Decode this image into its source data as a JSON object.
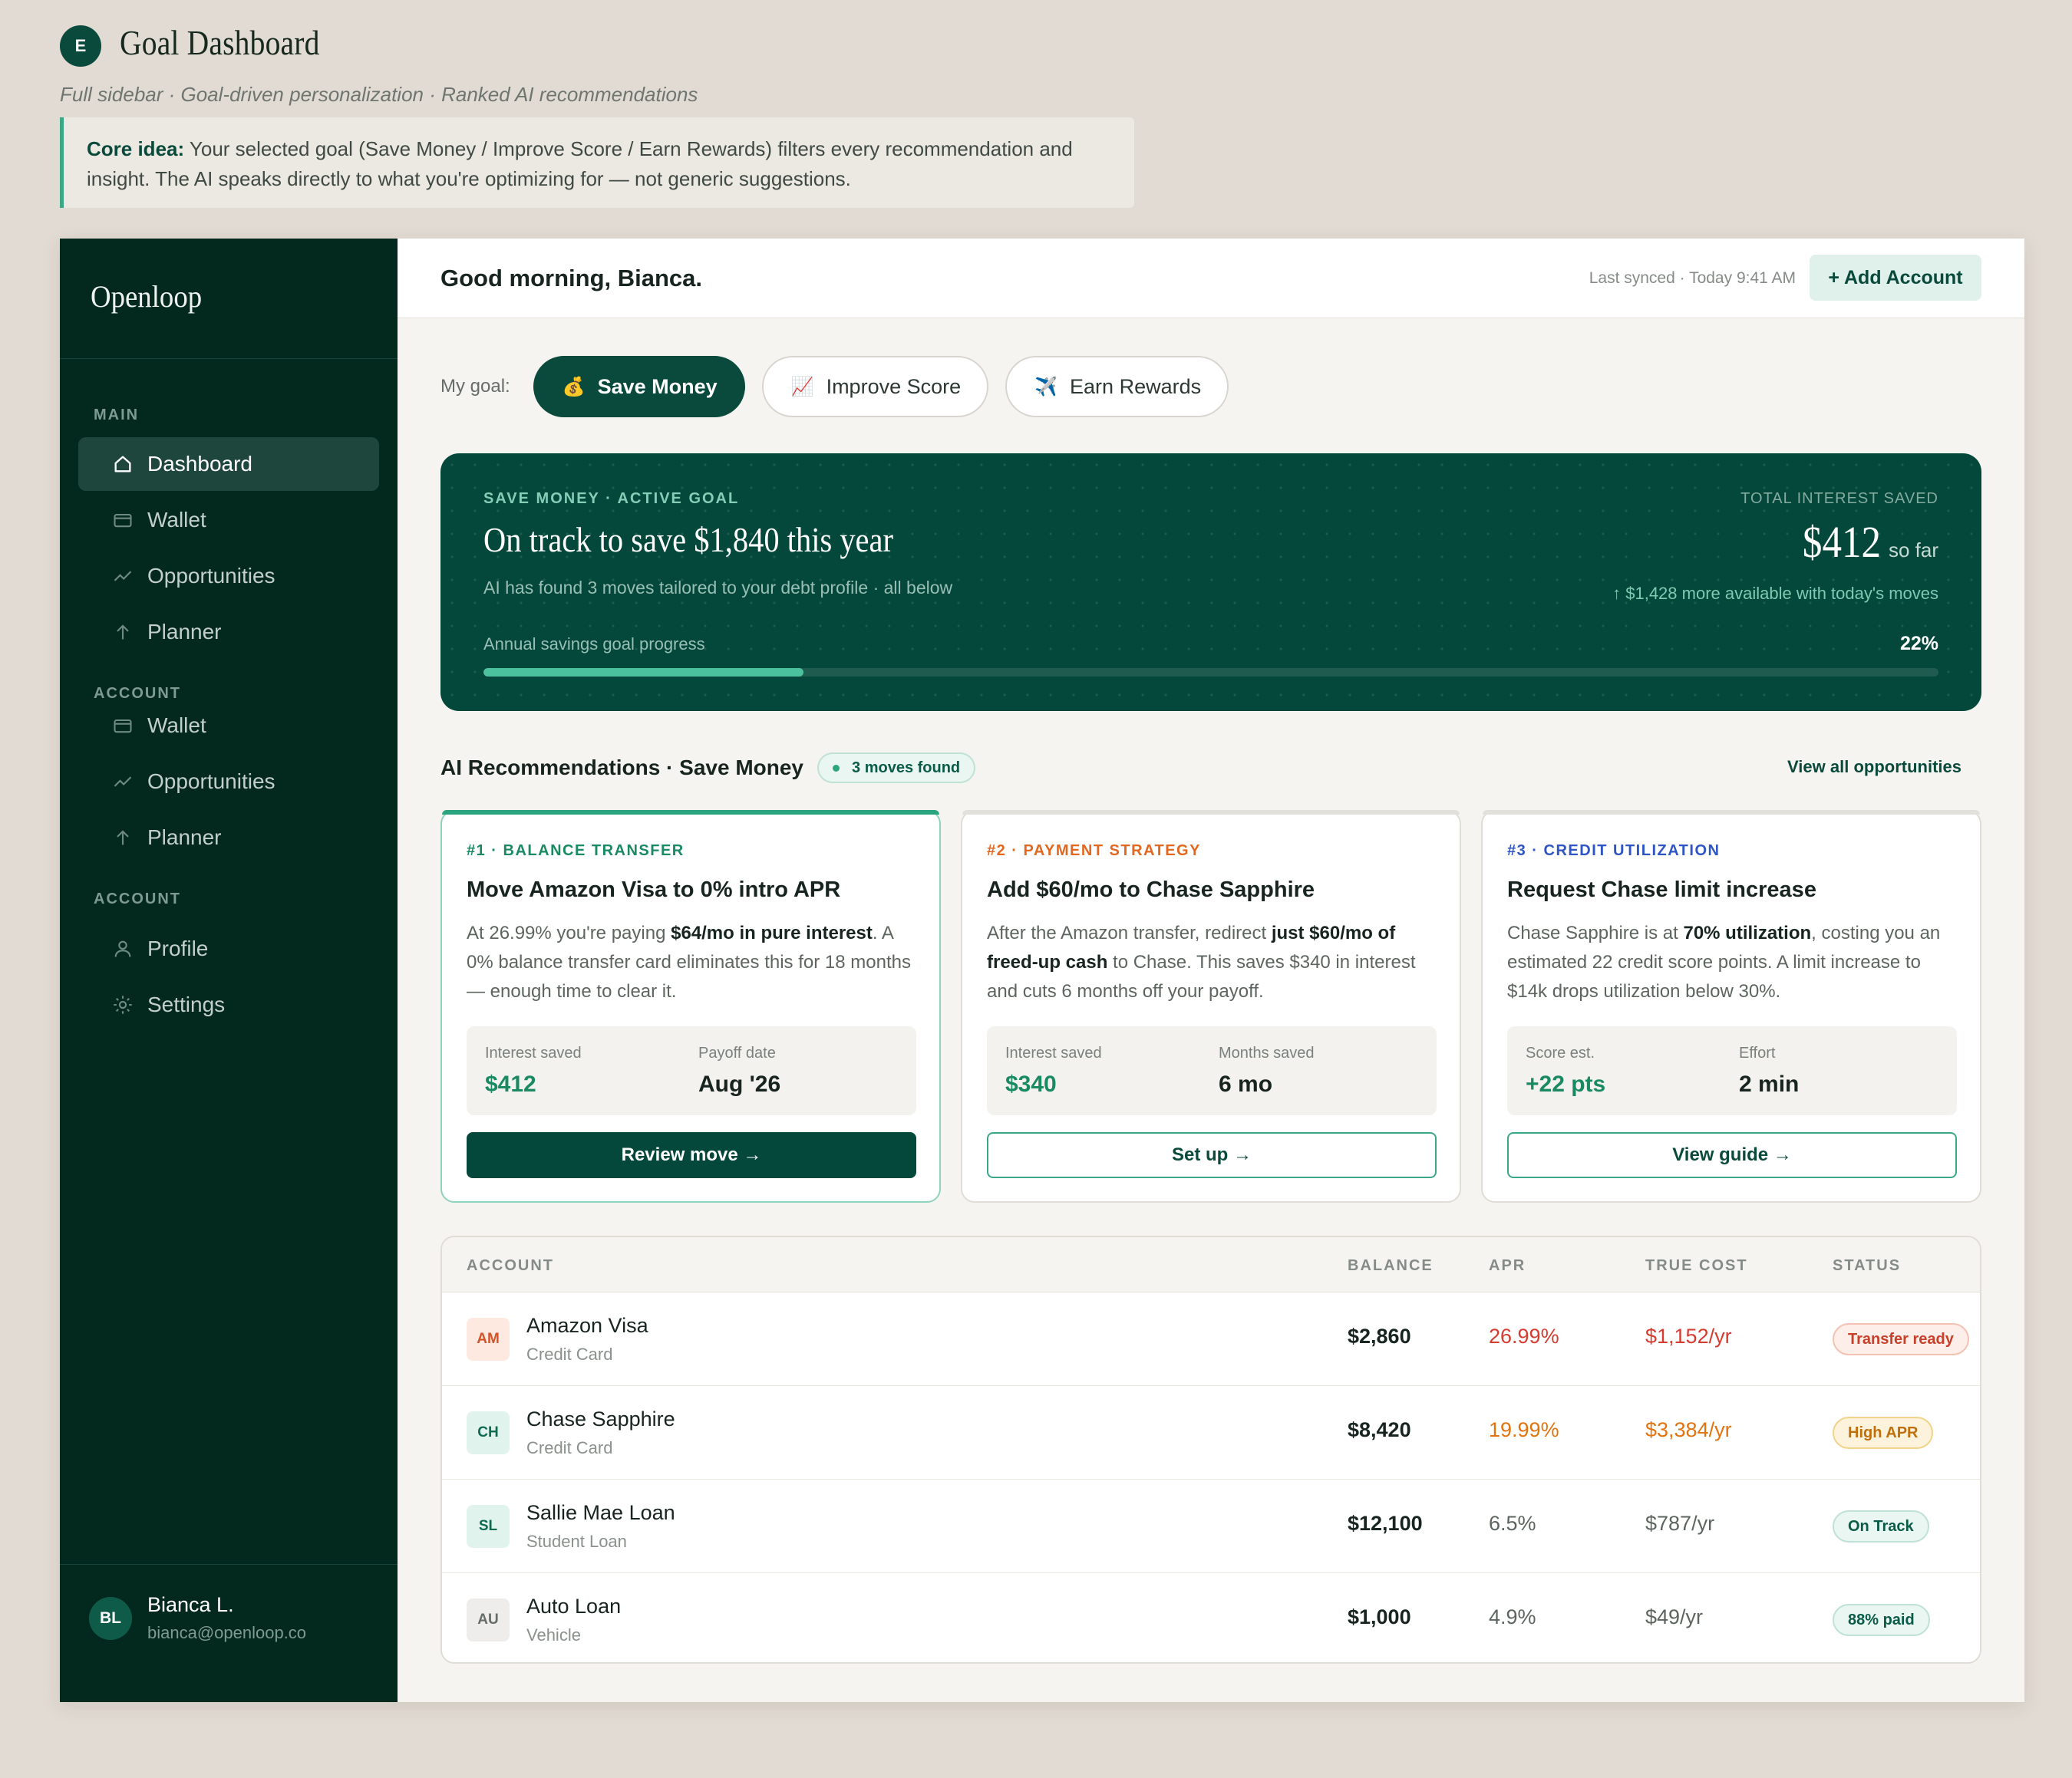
{
  "page": {
    "badge": "E",
    "title": "Goal Dashboard",
    "subtitle": "Full sidebar · Goal-driven personalization · Ranked AI recommendations",
    "core_idea_label": "Core idea:",
    "core_idea_text": " Your selected goal (Save Money / Improve Score / Earn Rewards) filters every recommendation and insight. The AI speaks directly to what you're optimizing for — not generic suggestions."
  },
  "sidebar": {
    "brand": "Openloop",
    "sections": [
      {
        "label": "MAIN",
        "items": [
          {
            "label": "Dashboard",
            "icon": "home-icon",
            "active": true
          },
          {
            "label": "Wallet",
            "icon": "wallet-icon"
          },
          {
            "label": "Opportunities",
            "icon": "trend-icon"
          },
          {
            "label": "Planner",
            "icon": "arrow-up-icon"
          }
        ]
      },
      {
        "label": "ACCOUNT",
        "items": [
          {
            "label": "Wallet",
            "icon": "wallet-icon"
          },
          {
            "label": "Opportunities",
            "icon": "trend-icon"
          },
          {
            "label": "Planner",
            "icon": "arrow-up-icon"
          }
        ]
      },
      {
        "label": "ACCOUNT",
        "items": [
          {
            "label": "Profile",
            "icon": "user-icon"
          },
          {
            "label": "Settings",
            "icon": "gear-icon"
          }
        ]
      }
    ],
    "user": {
      "initials": "BL",
      "name": "Bianca L.",
      "email": "bianca@openloop.co"
    }
  },
  "topbar": {
    "greeting": "Good morning, Bianca.",
    "synced": "Last synced · Today 9:41 AM",
    "add_account": "+ Add Account"
  },
  "goals": {
    "label": "My goal:",
    "options": [
      {
        "emoji": "💰",
        "label": "Save Money",
        "selected": true
      },
      {
        "emoji": "📈",
        "label": "Improve Score",
        "selected": false
      },
      {
        "emoji": "✈️",
        "label": "Earn Rewards",
        "selected": false
      }
    ]
  },
  "hero": {
    "tag": "SAVE MONEY · ACTIVE GOAL",
    "headline": "On track to save $1,840 this year",
    "sub": "AI has found 3 moves tailored to your debt profile · all below",
    "total_label": "TOTAL INTEREST SAVED",
    "total_amount": "$412",
    "total_suffix": "so far",
    "more": "↑ $1,428 more available with today's moves",
    "progress_label": "Annual savings goal progress",
    "progress_pct": "22%",
    "progress_value": 22
  },
  "recs": {
    "title": "AI Recommendations · Save Money",
    "badge": "3 moves found",
    "view_all": "View all opportunities",
    "cards": [
      {
        "tag": "#1 · BALANCE TRANSFER",
        "tag_color": "#1a8a63",
        "title": "Move Amazon Visa to 0% intro APR",
        "desc_parts": [
          "At 26.99% you're paying ",
          "$64/mo in pure interest",
          ". A 0% balance transfer card eliminates this for 18 months — enough time to clear it."
        ],
        "stats": [
          {
            "label": "Interest saved",
            "value": "$412",
            "green": true
          },
          {
            "label": "Payoff date",
            "value": "Aug '26",
            "green": false
          }
        ],
        "button": "Review move →",
        "button_style": "solid"
      },
      {
        "tag": "#2 · PAYMENT STRATEGY",
        "tag_color": "#e2671f",
        "title": "Add $60/mo to Chase Sapphire",
        "desc_parts": [
          "After the Amazon transfer, redirect ",
          "just $60/mo of freed-up cash",
          " to Chase. This saves $340 in interest and cuts 6 months off your payoff."
        ],
        "stats": [
          {
            "label": "Interest saved",
            "value": "$340",
            "green": true
          },
          {
            "label": "Months saved",
            "value": "6 mo",
            "green": false
          }
        ],
        "button": "Set up →",
        "button_style": "out"
      },
      {
        "tag": "#3 · CREDIT UTILIZATION",
        "tag_color": "#2f55c4",
        "title": "Request Chase limit increase",
        "desc_parts": [
          "Chase Sapphire is at ",
          "70% utilization",
          ", costing you an estimated 22 credit score points. A limit increase to $14k drops utilization below 30%."
        ],
        "stats": [
          {
            "label": "Score est.",
            "value": "+22 pts",
            "green": true
          },
          {
            "label": "Effort",
            "value": "2 min",
            "green": false
          }
        ],
        "button": "View guide →",
        "button_style": "out"
      }
    ]
  },
  "table": {
    "headers": [
      "ACCOUNT",
      "BALANCE",
      "APR",
      "TRUE COST",
      "STATUS"
    ],
    "rows": [
      {
        "initials": "AM",
        "av_bg": "#fde9df",
        "av_fg": "#d2542a",
        "name": "Amazon Visa",
        "type": "Credit Card",
        "balance": "$2,860",
        "apr": "26.99%",
        "cost": "$1,152/yr",
        "tone": "#d63b2f",
        "status": "Transfer ready",
        "st_bg": "#fdeee9",
        "st_bd": "#f4c2b2",
        "st_fg": "#c8402a"
      },
      {
        "initials": "CH",
        "av_bg": "#e0f3ec",
        "av_fg": "#0f6a50",
        "name": "Chase Sapphire",
        "type": "Credit Card",
        "balance": "$8,420",
        "apr": "19.99%",
        "cost": "$3,384/yr",
        "tone": "#e2740f",
        "status": "High APR",
        "st_bg": "#fdf3dc",
        "st_bd": "#f0d48a",
        "st_fg": "#c0700a"
      },
      {
        "initials": "SL",
        "av_bg": "#e0f3ec",
        "av_fg": "#0f6a50",
        "name": "Sallie Mae Loan",
        "type": "Student Loan",
        "balance": "$12,100",
        "apr": "6.5%",
        "cost": "$787/yr",
        "tone": "#5d655f",
        "status": "On Track",
        "st_bg": "#eaf6f1",
        "st_bd": "#bfe2d4",
        "st_fg": "#0a5b47"
      },
      {
        "initials": "AU",
        "av_bg": "#eeedeb",
        "av_fg": "#666d68",
        "name": "Auto Loan",
        "type": "Vehicle",
        "balance": "$1,000",
        "apr": "4.9%",
        "cost": "$49/yr",
        "tone": "#5d655f",
        "status": "88% paid",
        "st_bg": "#eaf6f1",
        "st_bd": "#bfe2d4",
        "st_fg": "#0a5b47"
      }
    ]
  }
}
